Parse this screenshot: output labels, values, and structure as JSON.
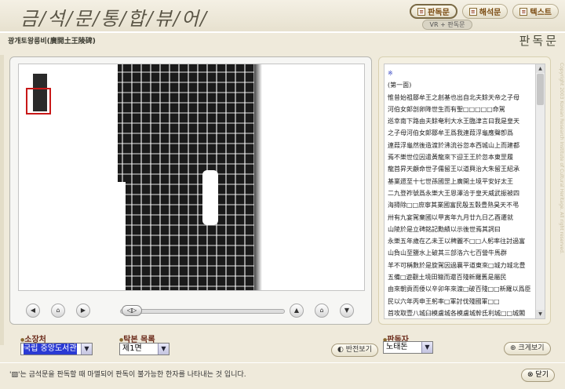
{
  "header": {
    "app_title": "금/석/문/통/합/뷰/어/",
    "tabs": [
      {
        "label": "판독문",
        "icon": "document-icon",
        "active": true
      },
      {
        "label": "해석문",
        "icon": "document-icon",
        "active": false
      },
      {
        "label": "텍스트",
        "icon": "document-icon",
        "active": false
      }
    ],
    "vr_badge": "VR + 판독문",
    "subtitle": "광개토왕릉비(廣開土王陵碑)",
    "mode_title": "판독문"
  },
  "image_viewer": {
    "controls": {
      "prev": "◀",
      "home": "⌂",
      "next": "▶",
      "up": "▲",
      "down": "▼",
      "slider_thumb": "◁▷"
    },
    "zoom_level": 0.05
  },
  "footer_controls": {
    "collection_label": "소장처",
    "collection_value": "국립 중앙도서관",
    "rubbing_label": "탁본 목록",
    "rubbing_value": "제1면",
    "invert_button": "반전보기",
    "reader_label": "판독자",
    "reader_value": "노태돈",
    "enlarge_button": "크게보기"
  },
  "text_panel": {
    "lines": [
      "※",
      "(第一面)",
      "惟昔始祖鄒牟王之創基也出自北夫餘天帝之子母",
      "河伯女郞剖卵降世生而有聖□□□□□命駕",
      "巡幸南下路由夫餘奄利大水王臨津言曰我是皇天",
      "之子母河伯女郞鄒牟王爲我連葭浮龜應聲卽爲",
      "連葭浮龜然後造渡於沸流谷忽本西城山上而建都",
      "焉不樂世位因遣黃龍來下迎王王於忽本東罡履",
      "龍首昇天顧命世子儒留王以道興治大朱留王紹承",
      "基業遝至十七世孫國罡上廣開土境平安好太王",
      "二九登祚號爲永樂大王恩澤洽于皇天威武振被四",
      "海掃除□□庶寧其業國富民殷五穀豊熟昊天不弔",
      "卅有九宴駕棄國以甲寅年九月廿九日乙酉遷就",
      "山陵於是立碑銘記勳績以示後世焉其詞曰",
      "永樂五年歲在乙未王以稗麗不□□人躬率往討過富",
      "山負山至鹽水上破其三部洛六七百營牛馬群",
      "羊不可稱數於是旋駕因過襄平道東來□城力城北豊",
      "五備□遊觀土境田獵而還百殘新羅舊是屬民",
      "由來朝貢而倭以辛卯年來渡□破百殘□□新羅以爲臣",
      "民以六年丙申王躬率□軍討伐殘國軍□□",
      "首攻取壹八城臼模盧城各模盧城幹氐利城□□城閣",
      "彌城牟盧城彌沙城□舍蔦城阿旦城古利城",
      "利城雜珍城奧利城勾牟城古模耶羅城頁□□□□城而"
    ]
  },
  "copyright": "Copyright 2003 Korean Research Institute of Cultural Heritage. All right reserved.",
  "footer": {
    "note": "'▨'는 금석문을 판독할 때 마멸되어 판독이 불가능한 한자를 나타내는 것 입니다.",
    "close_button": "닫기"
  }
}
